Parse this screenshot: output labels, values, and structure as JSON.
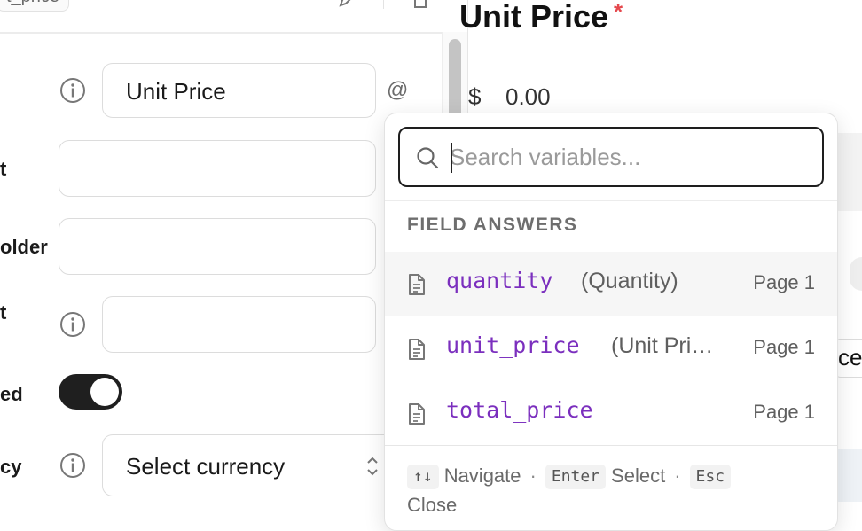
{
  "left_panel": {
    "tab_title": "t_price",
    "rows": [
      {
        "label": "",
        "value": "Unit Price",
        "at_symbol": "@"
      },
      {
        "label": "t",
        "value": ""
      },
      {
        "label": "older",
        "value": ""
      },
      {
        "label": "t",
        "value": ""
      },
      {
        "label": "ed"
      },
      {
        "label": "cy",
        "value": "Select currency"
      }
    ]
  },
  "preview": {
    "title": "Unit Price",
    "required_marker": "*",
    "currency_symbol": "$",
    "amount": "0.00",
    "partial_text": "ce"
  },
  "variable_picker": {
    "search_placeholder": "Search variables...",
    "section_title": "FIELD ANSWERS",
    "items": [
      {
        "name": "quantity",
        "label": "(Quantity)",
        "page": "Page 1"
      },
      {
        "name": "unit_price",
        "label": "(Unit Pri…",
        "page": "Page 1"
      },
      {
        "name": "total_price",
        "label": "",
        "page": "Page 1"
      }
    ],
    "footer": {
      "nav_key": "↑↓",
      "nav_label": "Navigate",
      "select_key": "Enter",
      "select_label": "Select",
      "close_key": "Esc",
      "close_label": "Close",
      "separator": "·"
    }
  },
  "colors": {
    "variable_name": "#7b2fbe",
    "required": "#e5484d",
    "toggle_on": "#1f1f1f"
  }
}
